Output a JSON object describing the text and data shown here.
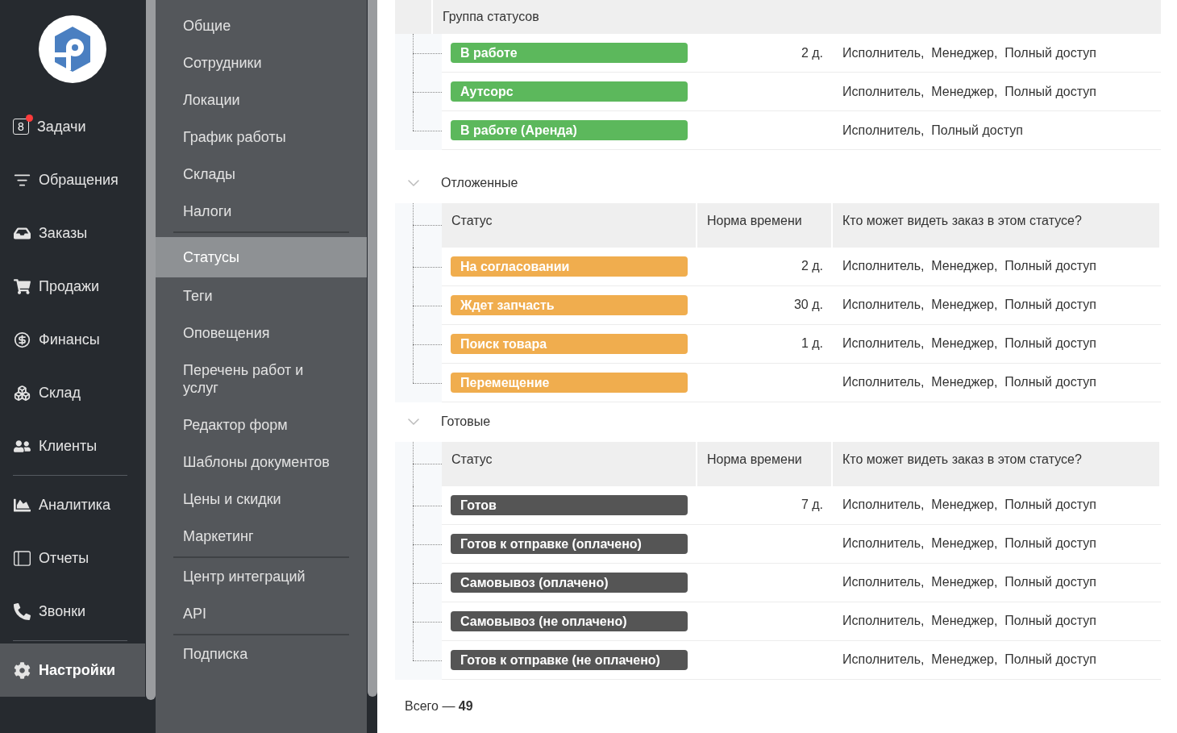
{
  "nav": {
    "items": [
      {
        "label": "Задачи",
        "count": "8",
        "alert": true,
        "selected": false,
        "divider_after": false
      },
      {
        "label": "Обращения",
        "selected": false,
        "divider_after": false
      },
      {
        "label": "Заказы",
        "selected": false,
        "divider_after": false
      },
      {
        "label": "Продажи",
        "selected": false,
        "divider_after": false
      },
      {
        "label": "Финансы",
        "selected": false,
        "divider_after": false
      },
      {
        "label": "Склад",
        "selected": false,
        "divider_after": false
      },
      {
        "label": "Клиенты",
        "selected": false,
        "divider_after": true
      },
      {
        "label": "Аналитика",
        "selected": false,
        "divider_after": false
      },
      {
        "label": "Отчеты",
        "selected": false,
        "divider_after": false
      },
      {
        "label": "Звонки",
        "selected": false,
        "divider_after": true
      },
      {
        "label": "Настройки",
        "selected": true,
        "divider_after": false
      }
    ]
  },
  "settings_menu": {
    "items": [
      {
        "label": "Общие",
        "selected": false,
        "divider_after": false
      },
      {
        "label": "Сотрудники",
        "selected": false,
        "divider_after": false
      },
      {
        "label": "Локации",
        "selected": false,
        "divider_after": false
      },
      {
        "label": "График работы",
        "selected": false,
        "divider_after": false
      },
      {
        "label": "Склады",
        "selected": false,
        "divider_after": false
      },
      {
        "label": "Налоги",
        "selected": false,
        "divider_after": true
      },
      {
        "label": "Статусы",
        "selected": true,
        "divider_after": false
      },
      {
        "label": "Теги",
        "selected": false,
        "divider_after": false
      },
      {
        "label": "Оповещения",
        "selected": false,
        "divider_after": false
      },
      {
        "label": "Перечень работ и услуг",
        "selected": false,
        "divider_after": false
      },
      {
        "label": "Редактор форм",
        "selected": false,
        "divider_after": false
      },
      {
        "label": "Шаблоны документов",
        "selected": false,
        "divider_after": false
      },
      {
        "label": "Цены и скидки",
        "selected": false,
        "divider_after": false
      },
      {
        "label": "Маркетинг",
        "selected": false,
        "divider_after": true
      },
      {
        "label": "Центр интеграций",
        "selected": false,
        "divider_after": false
      },
      {
        "label": "API",
        "selected": false,
        "divider_after": true
      },
      {
        "label": "Подписка",
        "selected": false,
        "divider_after": false
      }
    ]
  },
  "table_header": {
    "label": "Группа статусов"
  },
  "groups": [
    {
      "rows": [
        {
          "status": "В работе",
          "color": "#5cb85c",
          "time": "2 д.",
          "roles": "Исполнитель,  Менеджер,  Полный доступ"
        },
        {
          "status": "Аутсорс",
          "color": "#5cb85c",
          "roles": "Исполнитель,  Менеджер,  Полный доступ"
        },
        {
          "status": "В работе (Аренда)",
          "color": "#5cb85c",
          "roles": "Исполнитель,  Полный доступ"
        }
      ]
    },
    {
      "name": "Отложенные",
      "expanded": true,
      "columns": [
        "Статус",
        "Норма времени",
        "Кто может видеть заказ в этом статусе?"
      ],
      "rows": [
        {
          "status": "На согласовании",
          "color": "#f0ad4e",
          "time": "2 д.",
          "roles": "Исполнитель,  Менеджер,  Полный доступ"
        },
        {
          "status": "Ждет запчасть",
          "color": "#f0ad4e",
          "time": "30 д.",
          "roles": "Исполнитель,  Менеджер,  Полный доступ"
        },
        {
          "status": "Поиск товара",
          "color": "#f0ad4e",
          "time": "1 д.",
          "roles": "Исполнитель,  Менеджер,  Полный доступ"
        },
        {
          "status": "Перемещение",
          "color": "#f0ad4e",
          "roles": "Исполнитель,  Менеджер,  Полный доступ"
        }
      ]
    },
    {
      "name": "Готовые",
      "expanded": true,
      "columns": [
        "Статус",
        "Норма времени",
        "Кто может видеть заказ в этом статусе?"
      ],
      "rows": [
        {
          "status": "Готов",
          "color": "#555555",
          "time": "7 д.",
          "roles": "Исполнитель,  Менеджер,  Полный доступ"
        },
        {
          "status": "Готов к отправке (оплачено)",
          "color": "#555555",
          "roles": "Исполнитель,  Менеджер,  Полный доступ"
        },
        {
          "status": "Самовывоз (оплачено)",
          "color": "#555555",
          "roles": "Исполнитель,  Менеджер,  Полный доступ"
        },
        {
          "status": "Самовывоз (не оплачено)",
          "color": "#555555",
          "roles": "Исполнитель,  Менеджер,  Полный доступ"
        },
        {
          "status": "Готов к отправке (не оплачено)",
          "color": "#555555",
          "roles": "Исполнитель,  Менеджер,  Полный доступ"
        }
      ]
    }
  ],
  "footer": {
    "label": "Всего —",
    "count": "49"
  }
}
